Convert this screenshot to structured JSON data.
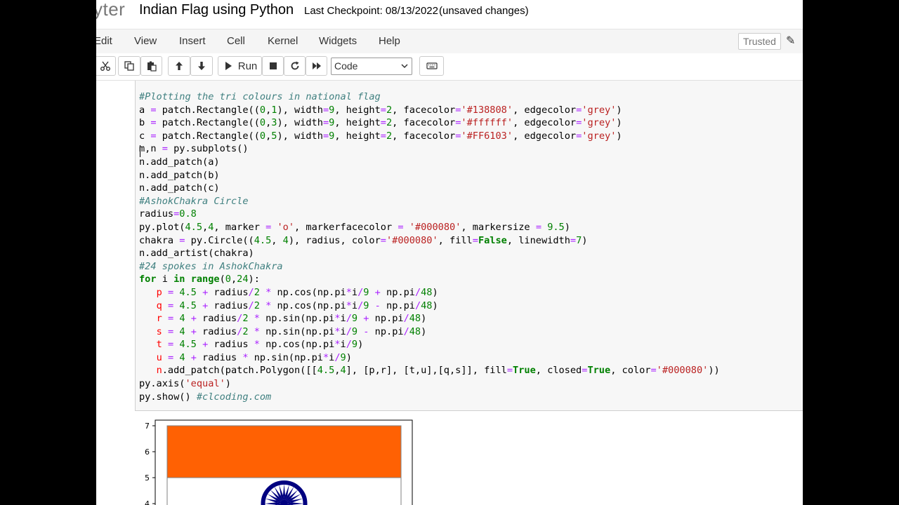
{
  "header": {
    "logo_text": "yter",
    "notebook_title": "Indian Flag using Python",
    "checkpoint": "Last Checkpoint: 08/13/2022",
    "autosave_status": "(unsaved changes)"
  },
  "menubar": {
    "items": [
      "Edit",
      "View",
      "Insert",
      "Cell",
      "Kernel",
      "Widgets",
      "Help"
    ],
    "trusted_label": "Trusted"
  },
  "toolbar": {
    "run_label": "Run",
    "cell_type": "Code"
  },
  "code_lines": [
    "#Plotting the tri colours in national flag",
    "a = patch.Rectangle((0,1), width=9, height=2, facecolor='#138808', edgecolor='grey')",
    "b = patch.Rectangle((0,3), width=9, height=2, facecolor='#ffffff', edgecolor='grey')",
    "c = patch.Rectangle((0,5), width=9, height=2, facecolor='#FF6103', edgecolor='grey')",
    "m,n = py.subplots()",
    "n.add_patch(a)",
    "n.add_patch(b)",
    "n.add_patch(c)",
    "#AshokChakra Circle",
    "radius=0.8",
    "py.plot(4.5,4, marker = 'o', markerfacecolor = '#000080', markersize = 9.5)",
    "chakra = py.Circle((4.5, 4), radius, color='#000080', fill=False, linewidth=7)",
    "n.add_artist(chakra)",
    "#24 spokes in AshokChakra",
    "for i in range(0,24):",
    "   p = 4.5 + radius/2 * np.cos(np.pi*i/9 + np.pi/48)",
    "   q = 4.5 + radius/2 * np.cos(np.pi*i/9 - np.pi/48)",
    "   r = 4 + radius/2 * np.sin(np.pi*i/9 + np.pi/48)",
    "   s = 4 + radius/2 * np.sin(np.pi*i/9 - np.pi/48)",
    "   t = 4.5 + radius * np.cos(np.pi*i/9)",
    "   u = 4 + radius * np.sin(np.pi*i/9)",
    "   n.add_patch(patch.Polygon([[4.5,4], [p,r], [t,u],[q,s]], fill=True, closed=True, color='#000080'))",
    "py.axis('equal')",
    "py.show() #clcoding.com"
  ],
  "output_plot": {
    "y_ticks": [
      "7",
      "6",
      "5",
      "4"
    ],
    "colors": {
      "saffron": "#FF6103",
      "white": "#ffffff",
      "green": "#138808",
      "chakra": "#000080",
      "edge": "grey"
    }
  }
}
